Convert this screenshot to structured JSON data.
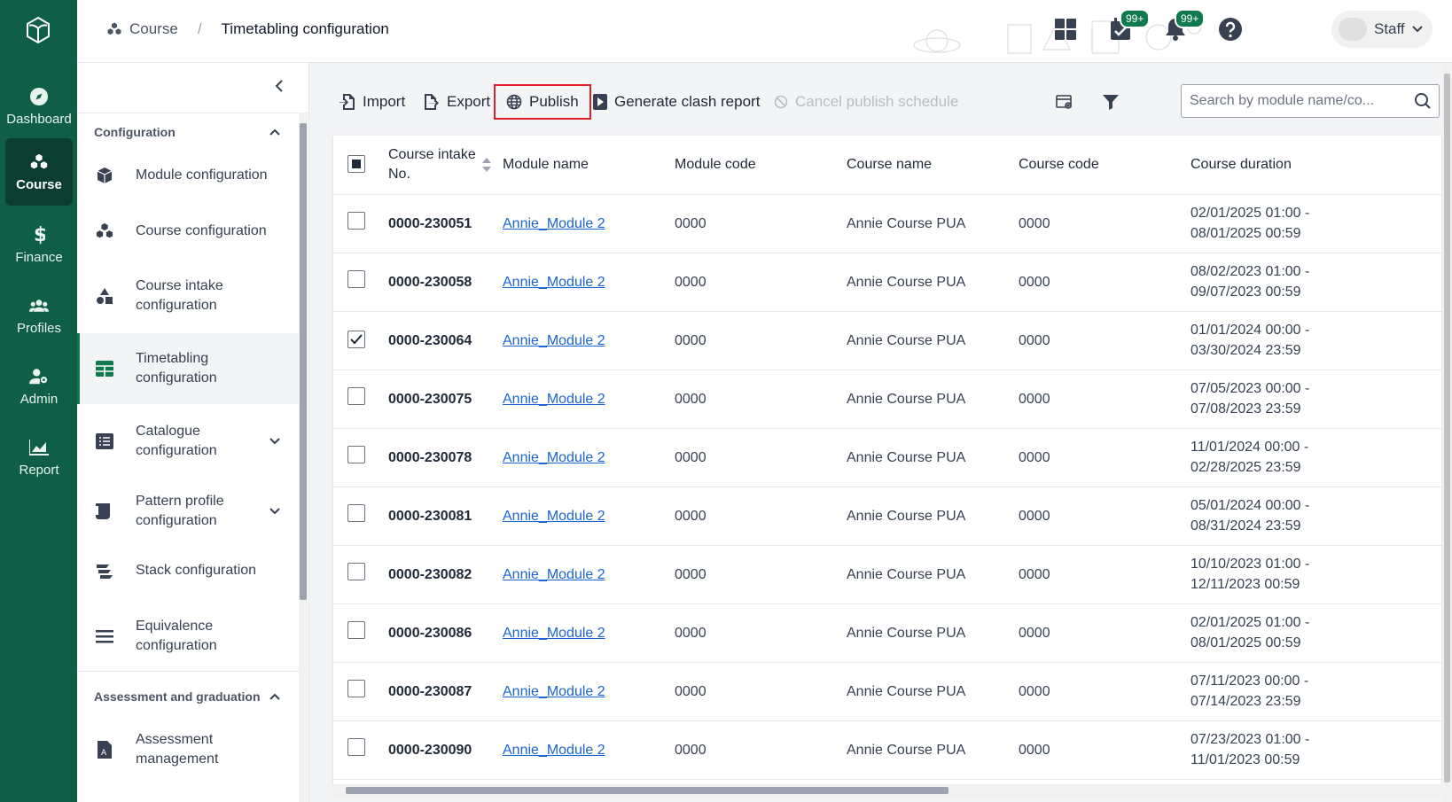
{
  "rail": {
    "items": [
      {
        "label": "Dashboard",
        "icon": "compass-icon"
      },
      {
        "label": "Course",
        "icon": "cubes-icon",
        "active": true
      },
      {
        "label": "Finance",
        "icon": "dollar-icon"
      },
      {
        "label": "Profiles",
        "icon": "users-icon"
      },
      {
        "label": "Admin",
        "icon": "user-gear-icon"
      },
      {
        "label": "Report",
        "icon": "chart-icon"
      }
    ]
  },
  "breadcrumb": {
    "parent": "Course",
    "current": "Timetabling configuration"
  },
  "header": {
    "tasks_badge": "99+",
    "notifications_badge": "99+",
    "user_label": "Staff"
  },
  "sidebar": {
    "section_configuration": "Configuration",
    "items": [
      {
        "label": "Module configuration",
        "icon": "cube-icon"
      },
      {
        "label": "Course configuration",
        "icon": "cubes-icon"
      },
      {
        "label": "Course intake configuration",
        "icon": "shapes-icon"
      },
      {
        "label": "Timetabling configuration",
        "icon": "table-icon",
        "active": true
      },
      {
        "label": "Catalogue configuration",
        "icon": "list-icon",
        "expandable": true
      },
      {
        "label": "Pattern profile configuration",
        "icon": "scroll-icon",
        "expandable": true
      },
      {
        "label": "Stack configuration",
        "icon": "stack-icon"
      },
      {
        "label": "Equivalence configuration",
        "icon": "equals-icon"
      }
    ],
    "section_assessment": "Assessment and graduation",
    "assessment_items": [
      {
        "label": "Assessment management",
        "icon": "assessment-icon"
      }
    ]
  },
  "toolbar": {
    "import": "Import",
    "export": "Export",
    "publish": "Publish",
    "clash_report": "Generate clash report",
    "cancel_publish": "Cancel publish schedule",
    "search_placeholder": "Search by module name/co..."
  },
  "table": {
    "columns": [
      "Course intake No.",
      "Module name",
      "Module code",
      "Course name",
      "Course code",
      "Course duration"
    ],
    "rows": [
      {
        "intake": "0000-230051",
        "module": "Annie_Module 2",
        "module_code": "0000",
        "course": "Annie Course PUA",
        "course_code": "0000",
        "duration_start": "02/01/2025 01:00 -",
        "duration_end": "08/01/2025 00:59",
        "checked": false
      },
      {
        "intake": "0000-230058",
        "module": "Annie_Module 2",
        "module_code": "0000",
        "course": "Annie Course PUA",
        "course_code": "0000",
        "duration_start": "08/02/2023 01:00 -",
        "duration_end": "09/07/2023 00:59",
        "checked": false
      },
      {
        "intake": "0000-230064",
        "module": "Annie_Module 2",
        "module_code": "0000",
        "course": "Annie Course PUA",
        "course_code": "0000",
        "duration_start": "01/01/2024 00:00 -",
        "duration_end": "03/30/2024 23:59",
        "checked": true
      },
      {
        "intake": "0000-230075",
        "module": "Annie_Module 2",
        "module_code": "0000",
        "course": "Annie Course PUA",
        "course_code": "0000",
        "duration_start": "07/05/2023 00:00 -",
        "duration_end": "07/08/2023 23:59",
        "checked": false
      },
      {
        "intake": "0000-230078",
        "module": "Annie_Module 2",
        "module_code": "0000",
        "course": "Annie Course PUA",
        "course_code": "0000",
        "duration_start": "11/01/2024 00:00 -",
        "duration_end": "02/28/2025 23:59",
        "checked": false
      },
      {
        "intake": "0000-230081",
        "module": "Annie_Module 2",
        "module_code": "0000",
        "course": "Annie Course PUA",
        "course_code": "0000",
        "duration_start": "05/01/2024 00:00 -",
        "duration_end": "08/31/2024 23:59",
        "checked": false
      },
      {
        "intake": "0000-230082",
        "module": "Annie_Module 2",
        "module_code": "0000",
        "course": "Annie Course PUA",
        "course_code": "0000",
        "duration_start": "10/10/2023 01:00 -",
        "duration_end": "12/11/2023 00:59",
        "checked": false
      },
      {
        "intake": "0000-230086",
        "module": "Annie_Module 2",
        "module_code": "0000",
        "course": "Annie Course PUA",
        "course_code": "0000",
        "duration_start": "02/01/2025 01:00 -",
        "duration_end": "08/01/2025 00:59",
        "checked": false
      },
      {
        "intake": "0000-230087",
        "module": "Annie_Module 2",
        "module_code": "0000",
        "course": "Annie Course PUA",
        "course_code": "0000",
        "duration_start": "07/11/2023 00:00 -",
        "duration_end": "07/14/2023 23:59",
        "checked": false
      },
      {
        "intake": "0000-230090",
        "module": "Annie_Module 2",
        "module_code": "0000",
        "course": "Annie Course PUA",
        "course_code": "0000",
        "duration_start": "07/23/2023 01:00 -",
        "duration_end": "11/01/2023 00:59",
        "checked": false
      }
    ]
  },
  "colors": {
    "brand": "#0f5f48",
    "accent": "#0f7a4f",
    "link": "#1c63d4",
    "highlight": "#e11d2a"
  }
}
